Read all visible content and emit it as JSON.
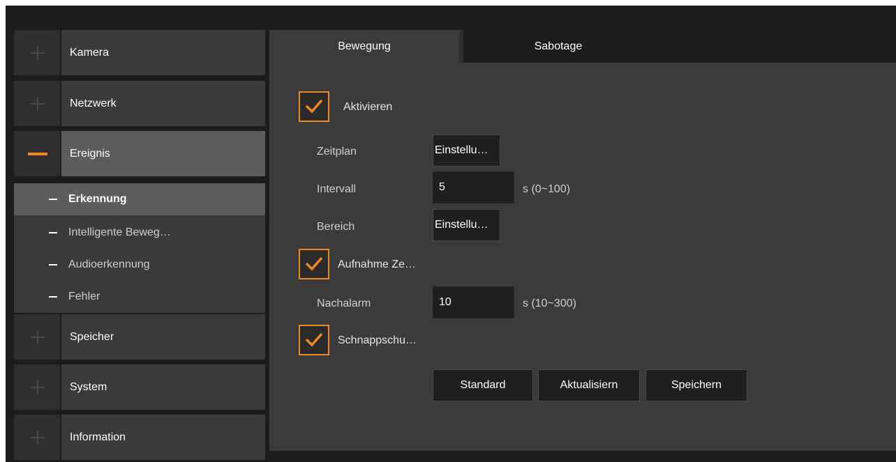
{
  "sidebar": {
    "items": [
      {
        "label": "Kamera",
        "expanded": false
      },
      {
        "label": "Netzwerk",
        "expanded": false
      },
      {
        "label": "Ereignis",
        "expanded": true
      },
      {
        "label": "Speicher",
        "expanded": false
      },
      {
        "label": "System",
        "expanded": false
      },
      {
        "label": "Information",
        "expanded": false
      }
    ],
    "subitems": [
      {
        "label": "Erkennung",
        "active": true
      },
      {
        "label": "Intelligente Beweg…",
        "active": false
      },
      {
        "label": "Audioerkennung",
        "active": false
      },
      {
        "label": "Fehler",
        "active": false
      }
    ]
  },
  "tabs": [
    {
      "label": "Bewegung",
      "active": true
    },
    {
      "label": "Sabotage",
      "active": false
    }
  ],
  "form": {
    "enable": {
      "label": "Aktivieren",
      "checked": true
    },
    "schedule": {
      "label": "Zeitplan",
      "button": "Einstellu…"
    },
    "interval": {
      "label": "Intervall",
      "value": "5",
      "unit": "s (0~100)"
    },
    "area": {
      "label": "Bereich",
      "button": "Einstellu…"
    },
    "record": {
      "label": "Aufnahme Ze…",
      "checked": true
    },
    "post_alarm": {
      "label": "Nachalarm",
      "value": "10",
      "unit": "s (10~300)"
    },
    "snapshot": {
      "label": "Schnappschu…",
      "checked": true
    }
  },
  "actions": {
    "default": "Standard",
    "refresh": "Aktualisiern",
    "save": "Speichern"
  },
  "colors": {
    "accent": "#f18a1a",
    "background": "#1c1c1c",
    "panel": "#3b3b3b"
  }
}
